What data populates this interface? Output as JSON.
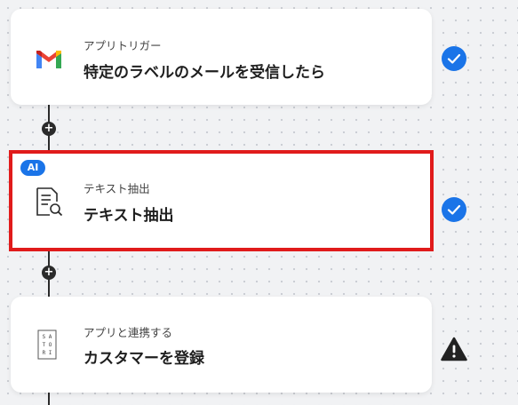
{
  "colors": {
    "accent": "#1a74e8",
    "selection": "#e01b1b",
    "connector": "#2b2b2b",
    "warning": "#222222"
  },
  "steps": [
    {
      "subtitle": "アプリトリガー",
      "title": "特定のラベルのメールを受信したら",
      "icon": "gmail-icon",
      "status": "complete"
    },
    {
      "badge": "AI",
      "subtitle": "テキスト抽出",
      "title": "テキスト抽出",
      "icon": "document-search-icon",
      "status": "complete",
      "selected": true
    },
    {
      "subtitle": "アプリと連携する",
      "title": "カスタマーを登録",
      "icon": "satori-icon",
      "icon_text": [
        "S",
        "A",
        "T",
        "O",
        "R",
        "I"
      ],
      "status": "warning"
    }
  ],
  "add_button_symbol": "+"
}
